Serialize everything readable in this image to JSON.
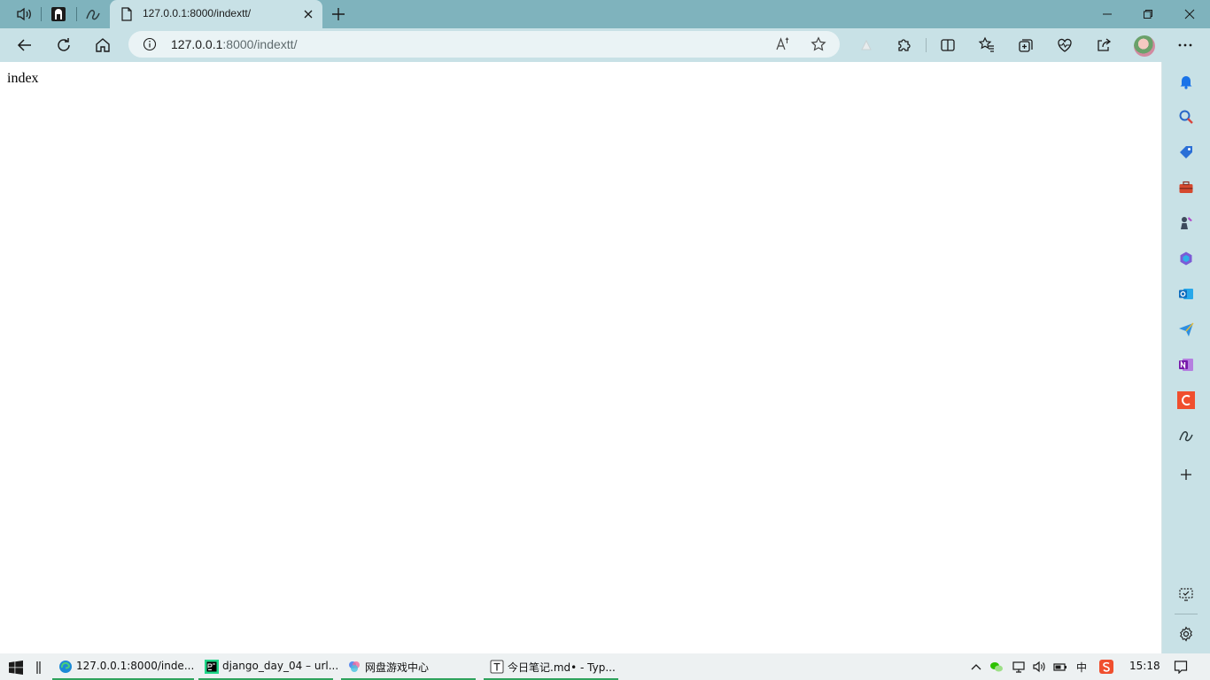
{
  "browser": {
    "tab": {
      "title": "127.0.0.1:8000/indextt/"
    },
    "address": {
      "host": "127.0.0.1",
      "rest": ":8000/indextt/"
    }
  },
  "page": {
    "text": "index"
  },
  "taskbar": {
    "items": [
      {
        "label": "127.0.0.1:8000/inde...",
        "icon": "edge-icon"
      },
      {
        "label": "django_day_04 – url...",
        "icon": "pycharm-icon"
      },
      {
        "label": "网盘游戏中心",
        "icon": "netdisk-game-icon"
      },
      {
        "label": "今日笔记.md• - Typ...",
        "icon": "typora-icon"
      }
    ],
    "ime": "中",
    "clock": "15:18"
  },
  "colors": {
    "tabstrip": "#7fb3bd",
    "toolbar": "#c8e1e6",
    "taskbar_active": "#2fa35d"
  }
}
